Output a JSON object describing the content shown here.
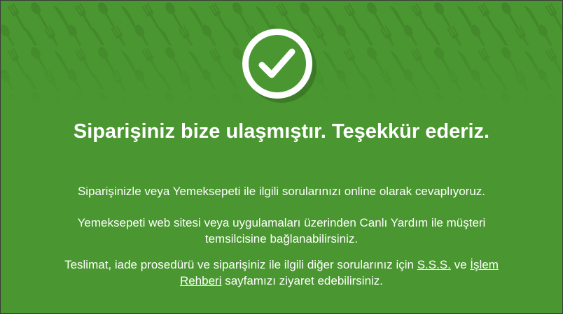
{
  "confirmation": {
    "title": "Siparişiniz bize ulaşmıştır. Teşekkür ederiz.",
    "line1": "Siparişinizle veya Yemeksepeti ile ilgili sorularınızı online olarak cevaplıyoruz.",
    "line2": "Yemeksepeti web sitesi veya uygulamaları üzerinden Canlı Yardım ile müşteri temsilcisine bağlanabilirsiniz.",
    "line3_prefix": "Teslimat, iade prosedürü ve siparişiniz ile ilgili diğer sorularınız için ",
    "link_sss": "S.S.S.",
    "line3_and": " ve ",
    "link_rehber": "İşlem Rehberi",
    "line3_suffix": " sayfamızı ziyaret edebilirsiniz."
  },
  "icons": {
    "status": "check-circle-icon",
    "background_pattern": "cutlery-pattern-icon"
  },
  "colors": {
    "background": "#4a9630",
    "text": "#ffffff"
  }
}
